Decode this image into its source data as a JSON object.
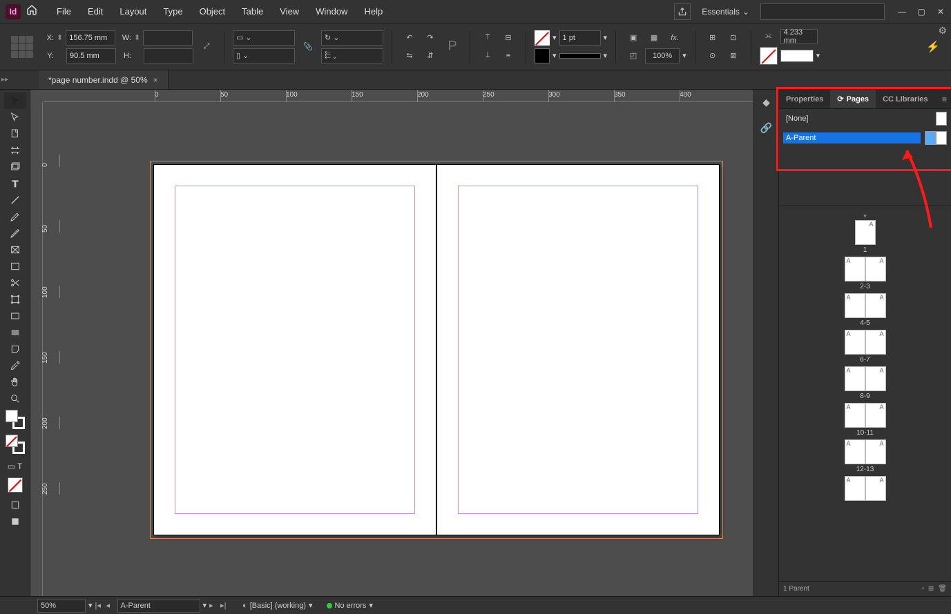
{
  "app": {
    "logo_text": "Id"
  },
  "menu": {
    "file": "File",
    "edit": "Edit",
    "layout": "Layout",
    "type": "Type",
    "object": "Object",
    "table": "Table",
    "view": "View",
    "window": "Window",
    "help": "Help"
  },
  "workspace": "Essentials",
  "control": {
    "x_label": "X:",
    "y_label": "Y:",
    "w_label": "W:",
    "h_label": "H:",
    "x_val": "156.75 mm",
    "y_val": "90.5 mm",
    "w_val": "",
    "h_val": "",
    "stroke_weight": "1 pt",
    "opacity": "100%",
    "board_width": "4.233 mm"
  },
  "doc_tab_title": "*page number.indd @ 50%",
  "ruler_h": [
    "0",
    "50",
    "100",
    "150",
    "200",
    "250",
    "300",
    "350",
    "400"
  ],
  "ruler_v": [
    "0",
    "50",
    "100",
    "150",
    "200",
    "250"
  ],
  "panel_tabs": {
    "properties": "Properties",
    "pages": "Pages",
    "cclib": "CC Libraries"
  },
  "masters": {
    "none_label": "[None]",
    "a_parent": "A-Parent"
  },
  "pages": [
    {
      "label": "1",
      "pages": [
        {
          "suffix": "A",
          "side": "r"
        }
      ]
    },
    {
      "label": "2-3",
      "pages": [
        {
          "suffix": "A",
          "side": "l"
        },
        {
          "suffix": "A",
          "side": "r"
        }
      ]
    },
    {
      "label": "4-5",
      "pages": [
        {
          "suffix": "A",
          "side": "l"
        },
        {
          "suffix": "A",
          "side": "r"
        }
      ]
    },
    {
      "label": "6-7",
      "pages": [
        {
          "suffix": "A",
          "side": "l"
        },
        {
          "suffix": "A",
          "side": "r"
        }
      ]
    },
    {
      "label": "8-9",
      "pages": [
        {
          "suffix": "A",
          "side": "l"
        },
        {
          "suffix": "A",
          "side": "r"
        }
      ]
    },
    {
      "label": "10-11",
      "pages": [
        {
          "suffix": "A",
          "side": "l"
        },
        {
          "suffix": "A",
          "side": "r"
        }
      ]
    },
    {
      "label": "12-13",
      "pages": [
        {
          "suffix": "A",
          "side": "l"
        },
        {
          "suffix": "A",
          "side": "r"
        }
      ]
    },
    {
      "label": "",
      "pages": [
        {
          "suffix": "A",
          "side": "l"
        },
        {
          "suffix": "A",
          "side": "r"
        }
      ]
    }
  ],
  "panel_footer": {
    "count": "1 Parent"
  },
  "status_bar": {
    "zoom": "50%",
    "page_nav": "A-Parent",
    "profile": "[Basic] (working)",
    "errors": "No errors"
  }
}
